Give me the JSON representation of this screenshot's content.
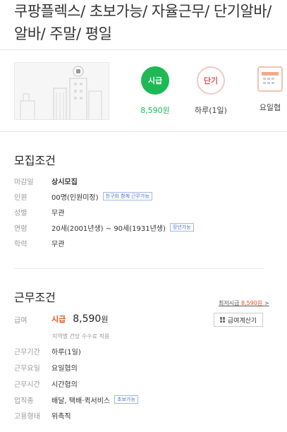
{
  "title": "쿠팡플렉스/ 초보가능/ 자율근무/ 단기알바/ 알바/ 주말/ 평일",
  "features": [
    {
      "icon_label": "시급",
      "caption": "8,590원",
      "style": "green"
    },
    {
      "icon_label": "단기",
      "caption": "하루(1일)",
      "style": "outline-red"
    },
    {
      "icon_label": "",
      "caption": "요일협",
      "style": "calendar"
    }
  ],
  "recruit": {
    "heading": "모집조건",
    "rows": [
      {
        "label": "마감일",
        "value": "상시모집",
        "tag": "",
        "bold": true
      },
      {
        "label": "인원",
        "value": "00명(인원미정)",
        "tag": "친구와 함께 근무가능",
        "bold": false
      },
      {
        "label": "성별",
        "value": "무관",
        "tag": "",
        "bold": false
      },
      {
        "label": "연령",
        "value": "20세(2001년생) ~ 90세(1931년생)",
        "tag": "장년가능",
        "bold": false
      },
      {
        "label": "학력",
        "value": "무관",
        "tag": "",
        "bold": false
      }
    ]
  },
  "work": {
    "heading": "근무조건",
    "min_wage_text": "최저시급",
    "min_wage_value": "8,590원",
    "min_wage_arrow": ">",
    "pay_label": "급여",
    "pay_type": "시급",
    "pay_amount": "8,590",
    "pay_unit": "원",
    "calc_button": "급여계산기",
    "note": "지역별 건당 수수료 적용",
    "rows": [
      {
        "label": "근무기간",
        "value": "하루(1일)",
        "tag": ""
      },
      {
        "label": "근무요일",
        "value": "요일협의",
        "tag": ""
      },
      {
        "label": "근무시간",
        "value": "시간협의",
        "tag": ""
      },
      {
        "label": "업직종",
        "value": "배달, 택배·퀵서비스",
        "tag": "초보가능"
      },
      {
        "label": "고용형태",
        "value": "위촉직",
        "tag": ""
      }
    ]
  },
  "colors": {
    "green": "#1db954",
    "orange": "#e8541e",
    "tag_blue": "#4a73c9"
  }
}
